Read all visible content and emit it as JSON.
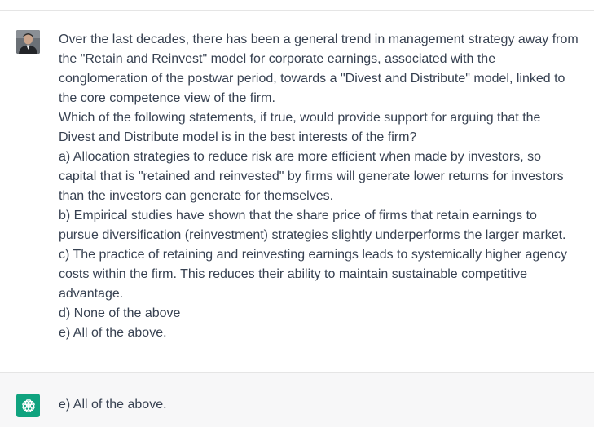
{
  "colors": {
    "assistant_bg": "#f7f7f8",
    "assistant_avatar": "#10a37f",
    "text": "#374151",
    "divider": "#e5e5e5"
  },
  "user_message": {
    "avatar_icon": "user-photo-avatar",
    "lines": [
      "Over the last decades, there has been a general trend in management strategy away from",
      "the \"Retain and Reinvest\" model for corporate earnings, associated with the",
      "conglomeration of the postwar period, towards a \"Divest and Distribute\" model, linked to",
      "the core competence view of the firm.",
      "Which of the following statements, if true, would provide support for arguing that the",
      "Divest and Distribute model is in the best interests of the firm?",
      "a) Allocation strategies to reduce risk are more efficient when made by investors, so",
      "capital  that is \"retained and reinvested\" by firms will generate lower returns for investors",
      "than the investors can generate for themselves.",
      "b) Empirical studies have shown that the share price of firms that retain earnings to",
      "pursue diversification (reinvestment) strategies slightly underperforms the larger market.",
      "c) The practice of retaining and reinvesting earnings leads to systemically higher agency",
      "costs within the firm. This reduces their ability to maintain sustainable competitive",
      "advantage.",
      "d) None of the above",
      "e) All of the above."
    ]
  },
  "assistant_message": {
    "avatar_icon": "openai-logo-icon",
    "text": "e) All of the above."
  }
}
